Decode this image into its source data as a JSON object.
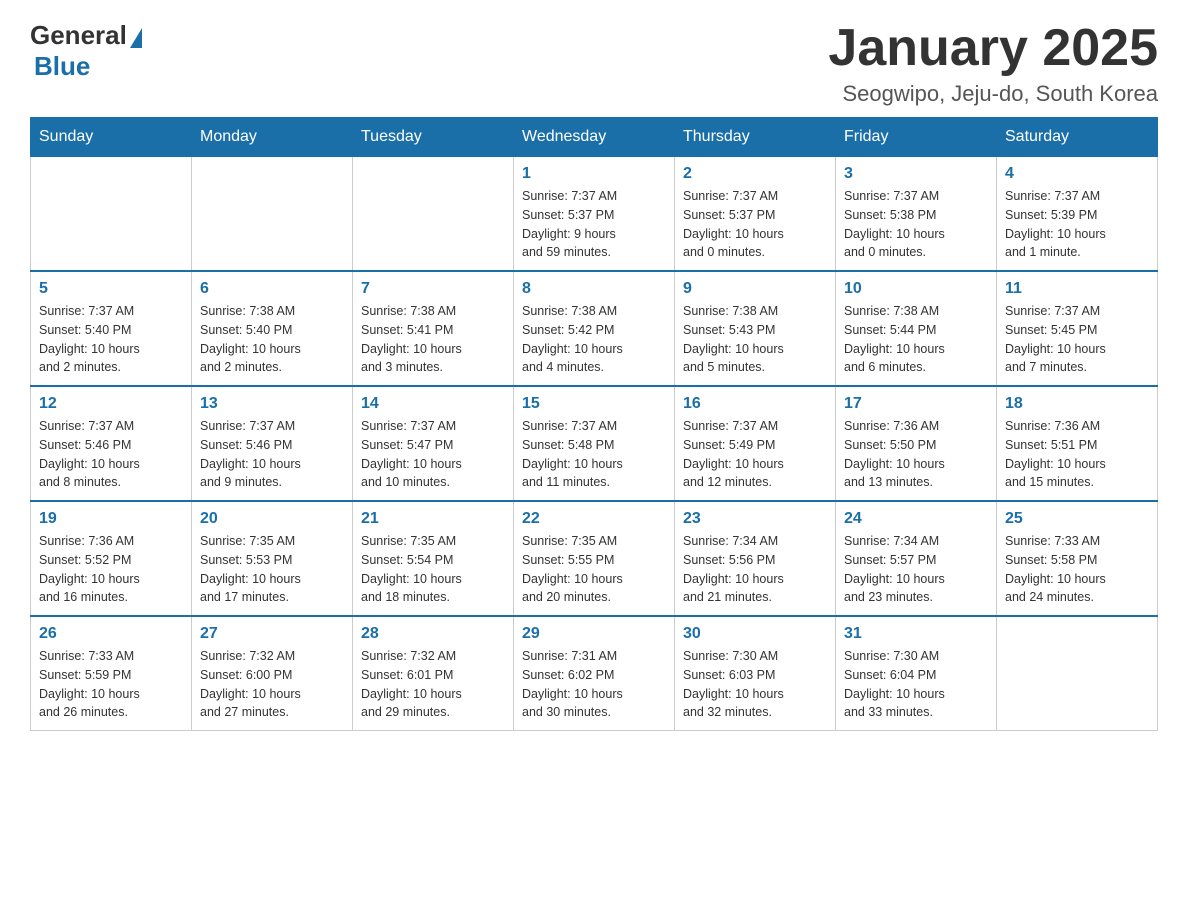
{
  "logo": {
    "general": "General",
    "blue": "Blue"
  },
  "title": "January 2025",
  "subtitle": "Seogwipo, Jeju-do, South Korea",
  "days_of_week": [
    "Sunday",
    "Monday",
    "Tuesday",
    "Wednesday",
    "Thursday",
    "Friday",
    "Saturday"
  ],
  "weeks": [
    [
      {
        "day": "",
        "info": ""
      },
      {
        "day": "",
        "info": ""
      },
      {
        "day": "",
        "info": ""
      },
      {
        "day": "1",
        "info": "Sunrise: 7:37 AM\nSunset: 5:37 PM\nDaylight: 9 hours\nand 59 minutes."
      },
      {
        "day": "2",
        "info": "Sunrise: 7:37 AM\nSunset: 5:37 PM\nDaylight: 10 hours\nand 0 minutes."
      },
      {
        "day": "3",
        "info": "Sunrise: 7:37 AM\nSunset: 5:38 PM\nDaylight: 10 hours\nand 0 minutes."
      },
      {
        "day": "4",
        "info": "Sunrise: 7:37 AM\nSunset: 5:39 PM\nDaylight: 10 hours\nand 1 minute."
      }
    ],
    [
      {
        "day": "5",
        "info": "Sunrise: 7:37 AM\nSunset: 5:40 PM\nDaylight: 10 hours\nand 2 minutes."
      },
      {
        "day": "6",
        "info": "Sunrise: 7:38 AM\nSunset: 5:40 PM\nDaylight: 10 hours\nand 2 minutes."
      },
      {
        "day": "7",
        "info": "Sunrise: 7:38 AM\nSunset: 5:41 PM\nDaylight: 10 hours\nand 3 minutes."
      },
      {
        "day": "8",
        "info": "Sunrise: 7:38 AM\nSunset: 5:42 PM\nDaylight: 10 hours\nand 4 minutes."
      },
      {
        "day": "9",
        "info": "Sunrise: 7:38 AM\nSunset: 5:43 PM\nDaylight: 10 hours\nand 5 minutes."
      },
      {
        "day": "10",
        "info": "Sunrise: 7:38 AM\nSunset: 5:44 PM\nDaylight: 10 hours\nand 6 minutes."
      },
      {
        "day": "11",
        "info": "Sunrise: 7:37 AM\nSunset: 5:45 PM\nDaylight: 10 hours\nand 7 minutes."
      }
    ],
    [
      {
        "day": "12",
        "info": "Sunrise: 7:37 AM\nSunset: 5:46 PM\nDaylight: 10 hours\nand 8 minutes."
      },
      {
        "day": "13",
        "info": "Sunrise: 7:37 AM\nSunset: 5:46 PM\nDaylight: 10 hours\nand 9 minutes."
      },
      {
        "day": "14",
        "info": "Sunrise: 7:37 AM\nSunset: 5:47 PM\nDaylight: 10 hours\nand 10 minutes."
      },
      {
        "day": "15",
        "info": "Sunrise: 7:37 AM\nSunset: 5:48 PM\nDaylight: 10 hours\nand 11 minutes."
      },
      {
        "day": "16",
        "info": "Sunrise: 7:37 AM\nSunset: 5:49 PM\nDaylight: 10 hours\nand 12 minutes."
      },
      {
        "day": "17",
        "info": "Sunrise: 7:36 AM\nSunset: 5:50 PM\nDaylight: 10 hours\nand 13 minutes."
      },
      {
        "day": "18",
        "info": "Sunrise: 7:36 AM\nSunset: 5:51 PM\nDaylight: 10 hours\nand 15 minutes."
      }
    ],
    [
      {
        "day": "19",
        "info": "Sunrise: 7:36 AM\nSunset: 5:52 PM\nDaylight: 10 hours\nand 16 minutes."
      },
      {
        "day": "20",
        "info": "Sunrise: 7:35 AM\nSunset: 5:53 PM\nDaylight: 10 hours\nand 17 minutes."
      },
      {
        "day": "21",
        "info": "Sunrise: 7:35 AM\nSunset: 5:54 PM\nDaylight: 10 hours\nand 18 minutes."
      },
      {
        "day": "22",
        "info": "Sunrise: 7:35 AM\nSunset: 5:55 PM\nDaylight: 10 hours\nand 20 minutes."
      },
      {
        "day": "23",
        "info": "Sunrise: 7:34 AM\nSunset: 5:56 PM\nDaylight: 10 hours\nand 21 minutes."
      },
      {
        "day": "24",
        "info": "Sunrise: 7:34 AM\nSunset: 5:57 PM\nDaylight: 10 hours\nand 23 minutes."
      },
      {
        "day": "25",
        "info": "Sunrise: 7:33 AM\nSunset: 5:58 PM\nDaylight: 10 hours\nand 24 minutes."
      }
    ],
    [
      {
        "day": "26",
        "info": "Sunrise: 7:33 AM\nSunset: 5:59 PM\nDaylight: 10 hours\nand 26 minutes."
      },
      {
        "day": "27",
        "info": "Sunrise: 7:32 AM\nSunset: 6:00 PM\nDaylight: 10 hours\nand 27 minutes."
      },
      {
        "day": "28",
        "info": "Sunrise: 7:32 AM\nSunset: 6:01 PM\nDaylight: 10 hours\nand 29 minutes."
      },
      {
        "day": "29",
        "info": "Sunrise: 7:31 AM\nSunset: 6:02 PM\nDaylight: 10 hours\nand 30 minutes."
      },
      {
        "day": "30",
        "info": "Sunrise: 7:30 AM\nSunset: 6:03 PM\nDaylight: 10 hours\nand 32 minutes."
      },
      {
        "day": "31",
        "info": "Sunrise: 7:30 AM\nSunset: 6:04 PM\nDaylight: 10 hours\nand 33 minutes."
      },
      {
        "day": "",
        "info": ""
      }
    ]
  ]
}
